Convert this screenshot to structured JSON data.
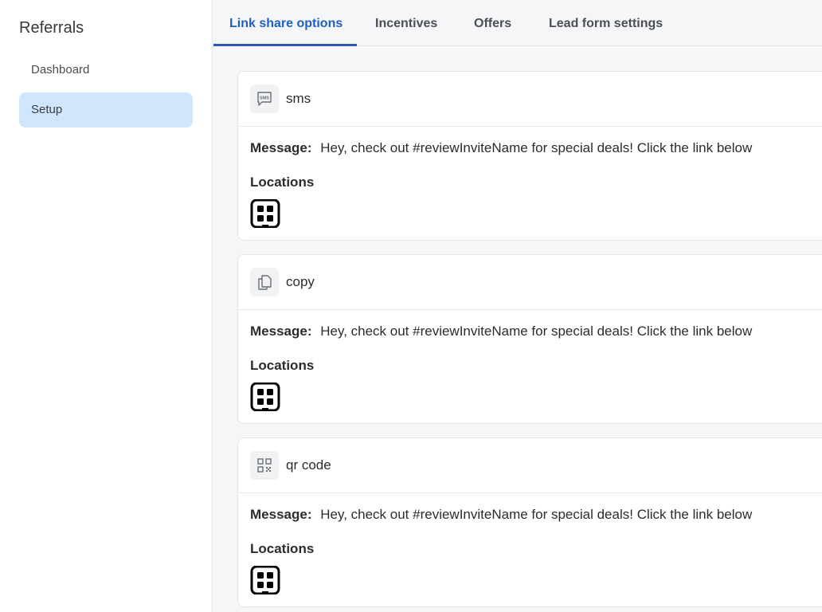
{
  "sidebar": {
    "title": "Referrals",
    "items": [
      {
        "label": "Dashboard",
        "active": false
      },
      {
        "label": "Setup",
        "active": true
      }
    ]
  },
  "tabs": [
    {
      "label": "Link share options",
      "active": true
    },
    {
      "label": "Incentives",
      "active": false
    },
    {
      "label": "Offers",
      "active": false
    },
    {
      "label": "Lead form settings",
      "active": false
    }
  ],
  "share_options": [
    {
      "name": "sms",
      "icon": "sms-icon",
      "message_label": "Message:",
      "message": "Hey, check out #reviewInviteName for special deals! Click the link below",
      "locations_label": "Locations",
      "location_icon": "location-app-icon"
    },
    {
      "name": "copy",
      "icon": "copy-icon",
      "message_label": "Message:",
      "message": "Hey, check out #reviewInviteName for special deals! Click the link below",
      "locations_label": "Locations",
      "location_icon": "location-app-icon"
    },
    {
      "name": "qr code",
      "icon": "qr-code-icon",
      "message_label": "Message:",
      "message": "Hey, check out #reviewInviteName for special deals! Click the link below",
      "locations_label": "Locations",
      "location_icon": "location-app-icon"
    }
  ],
  "colors": {
    "accent": "#2f57b4",
    "active_nav_bg": "#cfe6fc",
    "page_bg": "#f5f6f8"
  }
}
